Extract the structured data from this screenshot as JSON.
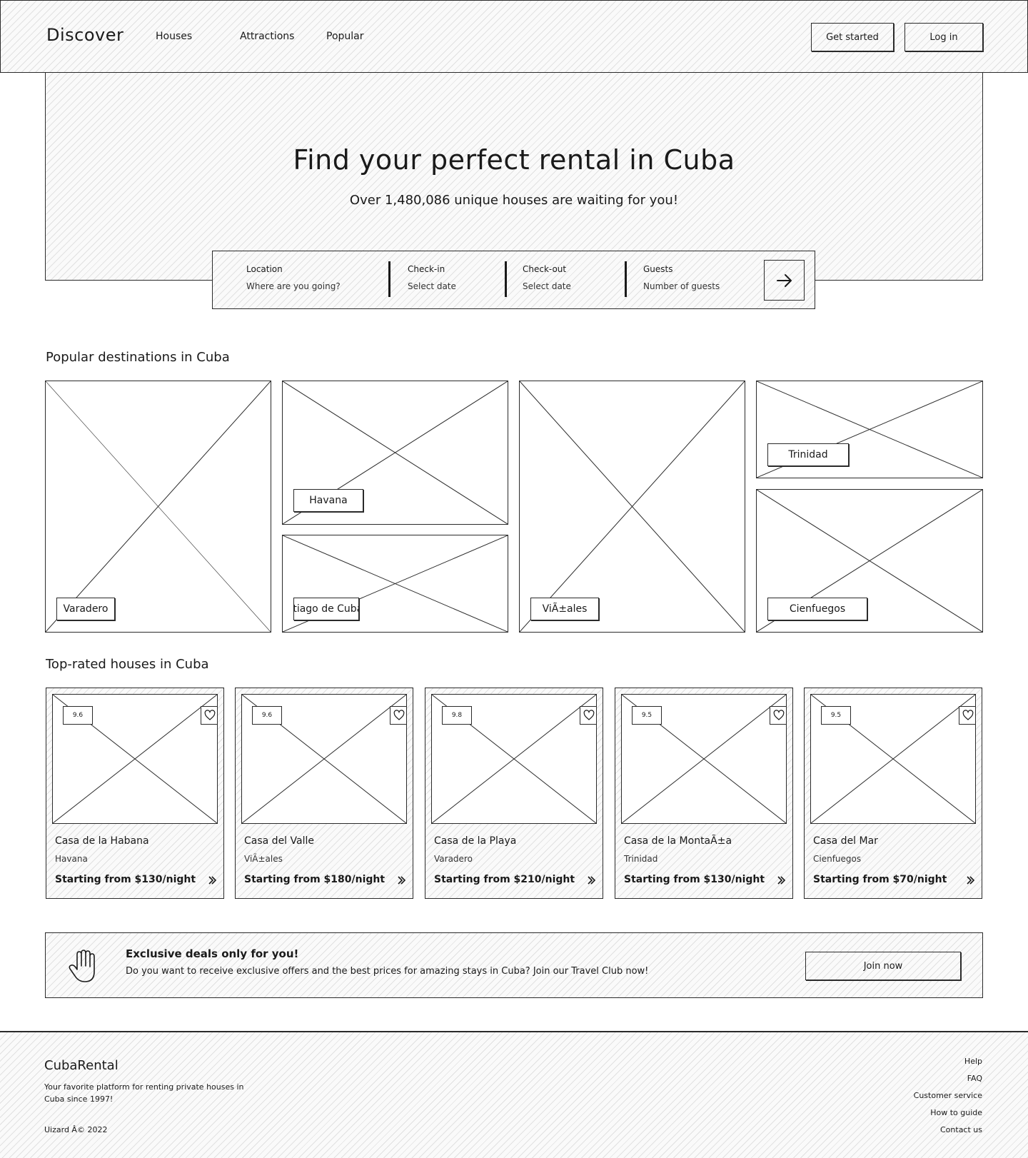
{
  "header": {
    "logo": "Discover",
    "nav": [
      "Houses",
      "Attractions",
      "Popular"
    ],
    "get_started": "Get started",
    "login": "Log in"
  },
  "hero": {
    "title": "Find your perfect rental in Cuba",
    "subtitle": "Over 1,480,086 unique houses are waiting for you!"
  },
  "search": {
    "location_label": "Location",
    "location_value": "Where are you going?",
    "checkin_label": "Check-in",
    "checkin_value": "Select date",
    "checkout_label": "Check-out",
    "checkout_value": "Select date",
    "guests_label": "Guests",
    "guests_value": "Number of guests",
    "submit_icon": "arrow-right-icon"
  },
  "destinations": {
    "title": "Popular destinations in Cuba",
    "items": [
      "Varadero",
      "Havana",
      "Santiago de Cuba",
      "ViÃ±ales",
      "Trinidad",
      "Cienfuegos"
    ]
  },
  "houses": {
    "title": "Top-rated houses in Cuba",
    "items": [
      {
        "rating": "9.6",
        "name": "Casa de la Habana",
        "location": "Havana",
        "price": "Starting from $130/night"
      },
      {
        "rating": "9.6",
        "name": "Casa del Valle",
        "location": "ViÃ±ales",
        "price": "Starting from $180/night"
      },
      {
        "rating": "9.8",
        "name": "Casa de la Playa",
        "location": "Varadero",
        "price": "Starting from $210/night"
      },
      {
        "rating": "9.5",
        "name": "Casa de la MontaÃ±a",
        "location": "Trinidad",
        "price": "Starting from $130/night"
      },
      {
        "rating": "9.5",
        "name": "Casa del Mar",
        "location": "Cienfuegos",
        "price": "Starting from $70/night"
      }
    ]
  },
  "deals": {
    "icon": "hand-icon",
    "title": "Exclusive deals only for you!",
    "text": "Do you want to receive exclusive offers and the best prices for amazing stays in Cuba? Join our Travel Club now!",
    "button": "Join now"
  },
  "footer": {
    "brand": "CubaRental",
    "description": "Your favorite platform for renting private houses in Cuba since 1997!",
    "copyright": "Uizard Â© 2022",
    "links": [
      "Help",
      "FAQ",
      "Customer service",
      "How to guide",
      "Contact us"
    ]
  },
  "colors": {
    "ink": "#2a2a2a",
    "background": "#ffffff",
    "hatch": "#e6e6e6"
  }
}
